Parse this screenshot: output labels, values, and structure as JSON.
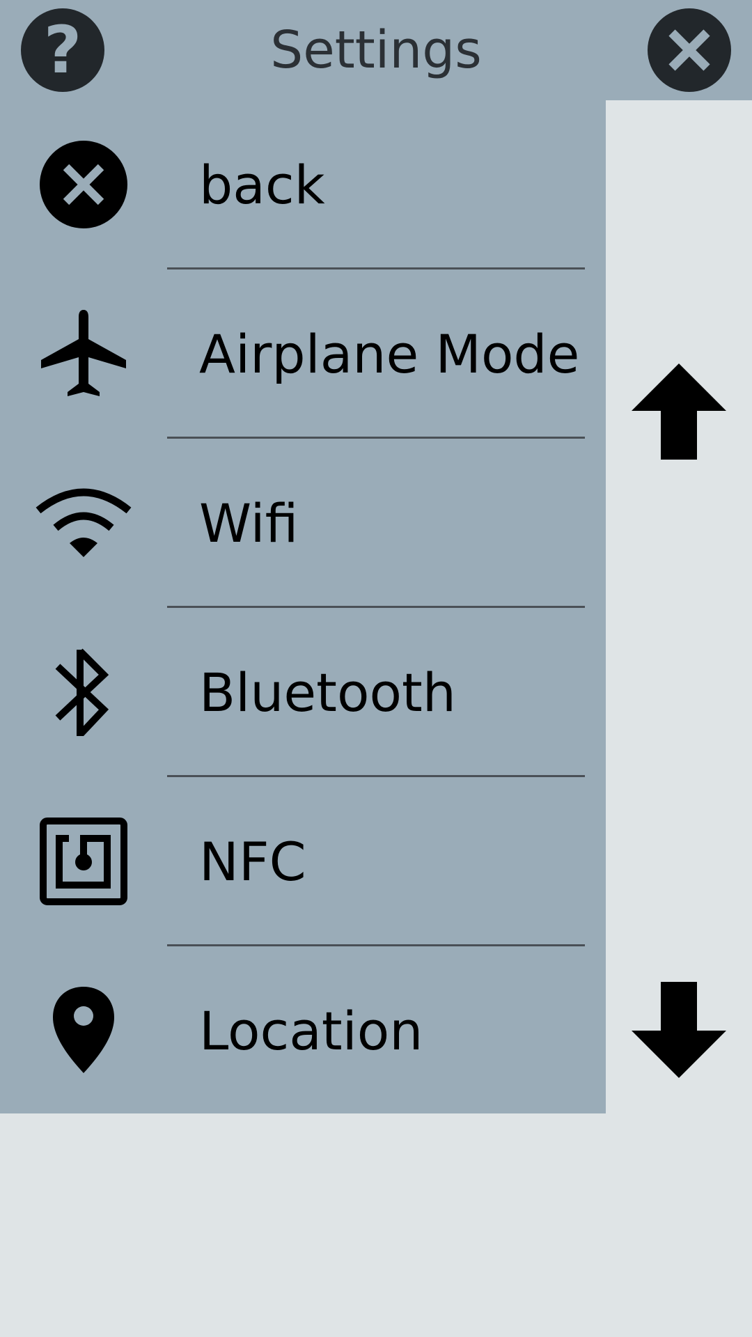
{
  "header": {
    "title": "Settings",
    "help_glyph": "?",
    "help_icon": "help-icon",
    "close_icon": "close-icon"
  },
  "menu": {
    "items": [
      {
        "label": "back",
        "icon": "close-circle-icon"
      },
      {
        "label": "Airplane Mode",
        "icon": "airplane-icon"
      },
      {
        "label": "Wifi",
        "icon": "wifi-icon"
      },
      {
        "label": "Bluetooth",
        "icon": "bluetooth-icon"
      },
      {
        "label": "NFC",
        "icon": "nfc-icon"
      },
      {
        "label": "Location",
        "icon": "location-pin-icon"
      }
    ]
  },
  "scroll": {
    "up_icon": "arrow-up-icon",
    "down_icon": "arrow-down-icon"
  },
  "colors": {
    "panel": "#9aacb8",
    "background": "#dfe4e6",
    "dark_button": "#22272b",
    "divider": "#4a5056",
    "title_text": "#2b3035"
  }
}
